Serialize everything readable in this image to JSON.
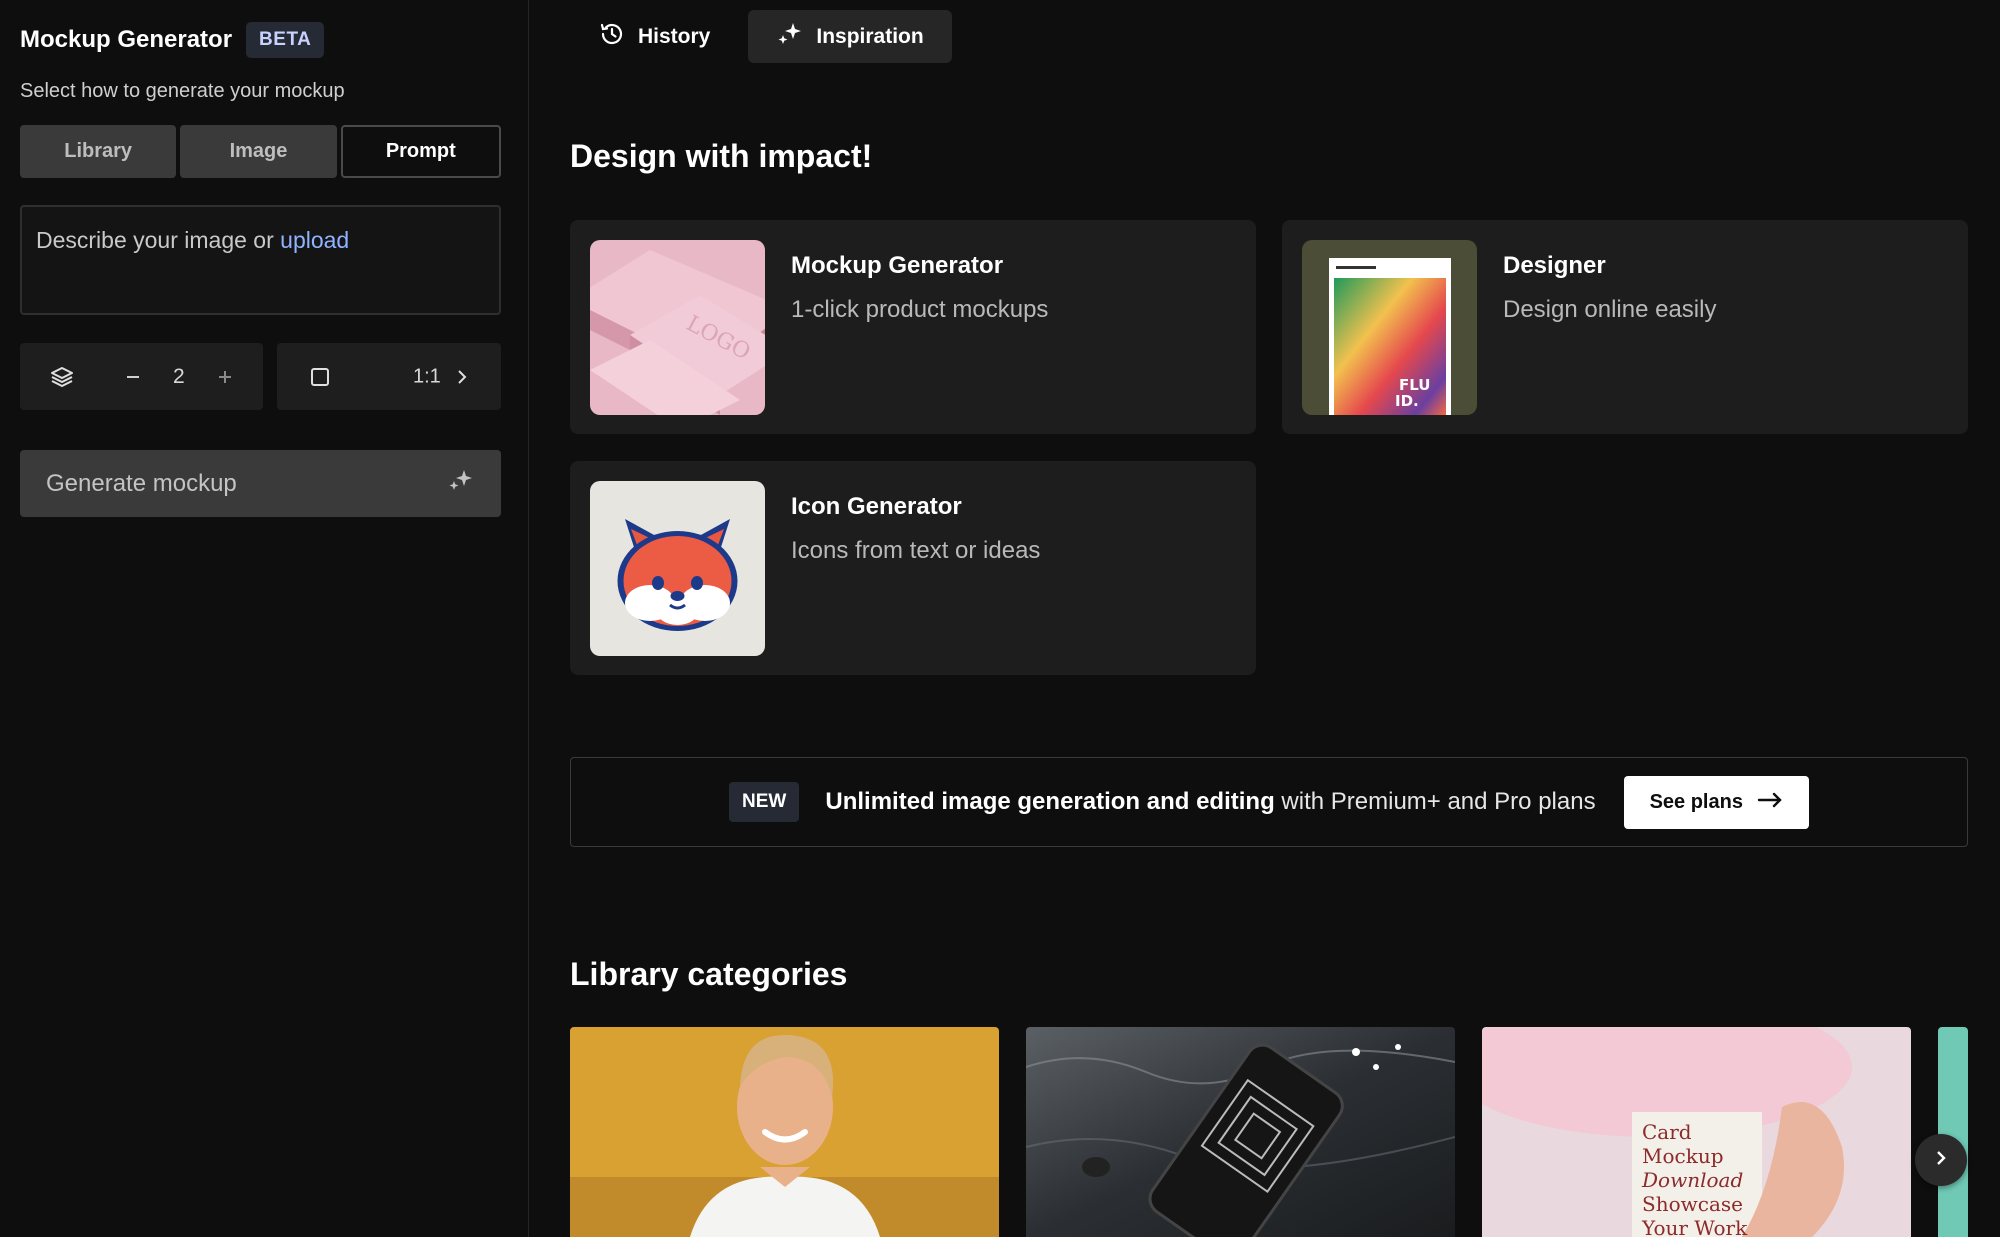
{
  "sidebar": {
    "title": "Mockup Generator",
    "badge": "BETA",
    "subtitle": "Select how to generate your mockup",
    "modes": [
      {
        "label": "Library",
        "active": false
      },
      {
        "label": "Image",
        "active": false
      },
      {
        "label": "Prompt",
        "active": true
      }
    ],
    "prompt": {
      "placeholder": "Describe your image or",
      "upload_link": "upload"
    },
    "count": {
      "value": "2",
      "icon": "layers-icon"
    },
    "ratio": {
      "value": "1:1",
      "icon": "square-icon"
    },
    "generate_label": "Generate mockup"
  },
  "topbar": {
    "tabs": [
      {
        "label": "History",
        "icon": "history-icon",
        "active": false
      },
      {
        "label": "Inspiration",
        "icon": "sparkles-icon",
        "active": true
      }
    ]
  },
  "tools": {
    "heading": "Design with impact!",
    "cards": [
      {
        "title": "Mockup Generator",
        "subtitle": "1-click product mockups"
      },
      {
        "title": "Designer",
        "subtitle": "Design online easily"
      },
      {
        "title": "Icon Generator",
        "subtitle": "Icons from text or ideas"
      }
    ],
    "poster_text": "FLU ID."
  },
  "banner": {
    "badge": "NEW",
    "bold_text": "Unlimited image generation and editing",
    "rest_text": " with Premium+ and Pro plans",
    "button_label": "See plans"
  },
  "library": {
    "heading": "Library categories",
    "card3_text": [
      "Card",
      "Mockup",
      "Download",
      "Showcase",
      "Your Work"
    ]
  },
  "colors": {
    "background": "#0e0e0e",
    "card": "#1d1d1d",
    "accent_link": "#8fb4ff",
    "badge_bg": "#262a35"
  }
}
